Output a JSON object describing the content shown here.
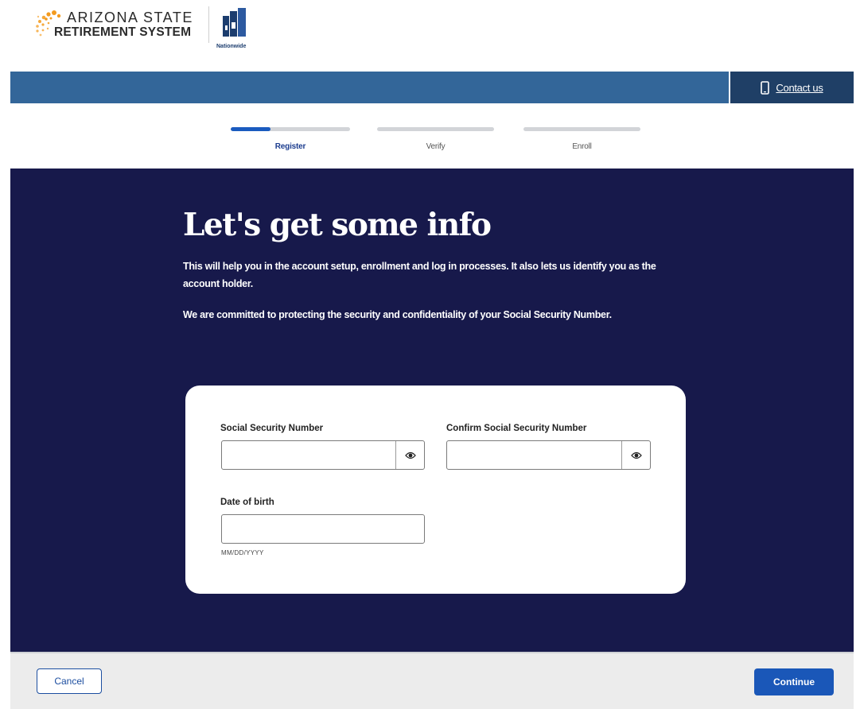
{
  "header": {
    "asrs_logo_line1": "ARIZONA STATE",
    "asrs_logo_line2": "RETIREMENT SYSTEM",
    "nationwide_logo_text": "Nationwide",
    "contact_label": "Contact us",
    "contact_icon": "mobile-phone-icon"
  },
  "stepper": {
    "steps": [
      {
        "label": "Register",
        "progress": 0.33,
        "active": true
      },
      {
        "label": "Verify",
        "progress": 0,
        "active": false
      },
      {
        "label": "Enroll",
        "progress": 0,
        "active": false
      }
    ]
  },
  "hero": {
    "title": "Let's get some info",
    "paragraph1": "This will help you in the account setup, enrollment and log in processes. It also lets us identify you as the account holder.",
    "paragraph2": "We are committed to protecting the security and confidentiality of your Social Security Number."
  },
  "form": {
    "ssn_label": "Social Security Number",
    "ssn_value": "",
    "confirm_ssn_label": "Confirm Social Security Number",
    "confirm_ssn_value": "",
    "dob_label": "Date of birth",
    "dob_value": "",
    "dob_hint": "MM/DD/YYYY",
    "show_icon": "eye-icon"
  },
  "footer": {
    "cancel_label": "Cancel",
    "continue_label": "Continue"
  },
  "colors": {
    "topbar": "#336699",
    "contact_bg": "#1f3f66",
    "hero_bg": "#17194b",
    "accent": "#1a57b8",
    "asrs_orange": "#f39a1e"
  }
}
